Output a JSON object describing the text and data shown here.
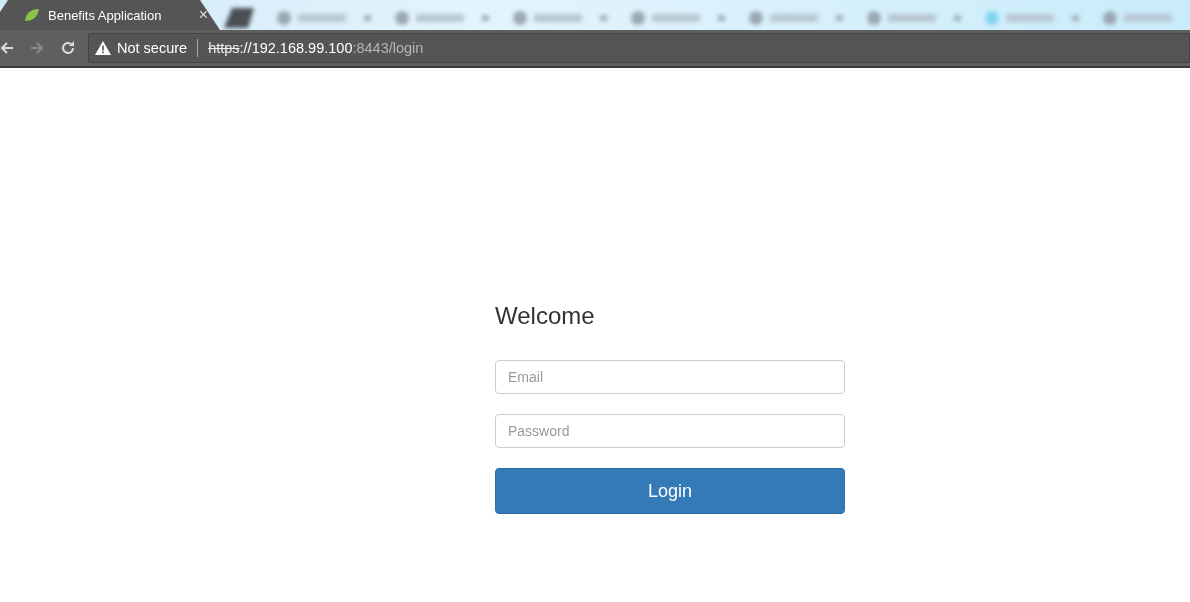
{
  "tabs": [
    {
      "label": "Benefits Application",
      "close": "×",
      "selected": true
    }
  ],
  "address_bar": {
    "security_label": "Not secure",
    "scheme": "https",
    "scheme_struck": true,
    "host": "://192.168.99.100",
    "path": ":8443/login"
  },
  "login": {
    "title": "Welcome",
    "email_placeholder": "Email",
    "password_placeholder": "Password",
    "button": "Login"
  }
}
